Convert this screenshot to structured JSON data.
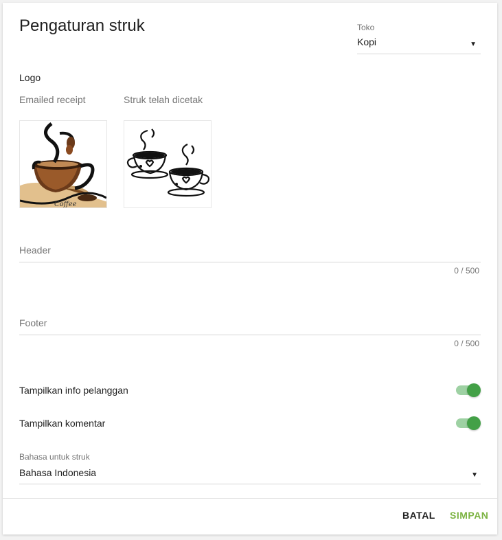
{
  "dialog": {
    "title": "Pengaturan struk"
  },
  "store": {
    "label": "Toko",
    "value": "Kopi"
  },
  "logo": {
    "heading": "Logo",
    "emailed": {
      "label": "Emailed receipt",
      "image": "coffee-cup-illustration"
    },
    "printed": {
      "label": "Struk telah dicetak",
      "image": "two-coffee-cups-line-art"
    }
  },
  "header_field": {
    "placeholder": "Header",
    "value": "",
    "counter": "0 / 500"
  },
  "footer_field": {
    "placeholder": "Footer",
    "value": "",
    "counter": "0 / 500"
  },
  "toggles": [
    {
      "label": "Tampilkan info pelanggan",
      "on": true
    },
    {
      "label": "Tampilkan komentar",
      "on": true
    }
  ],
  "language": {
    "label": "Bahasa untuk struk",
    "value": "Bahasa Indonesia"
  },
  "actions": {
    "cancel": "BATAL",
    "save": "SIMPAN"
  },
  "colors": {
    "accent": "#43a047",
    "save_text": "#7cb342",
    "toggle_track": "#9ed1a3"
  }
}
